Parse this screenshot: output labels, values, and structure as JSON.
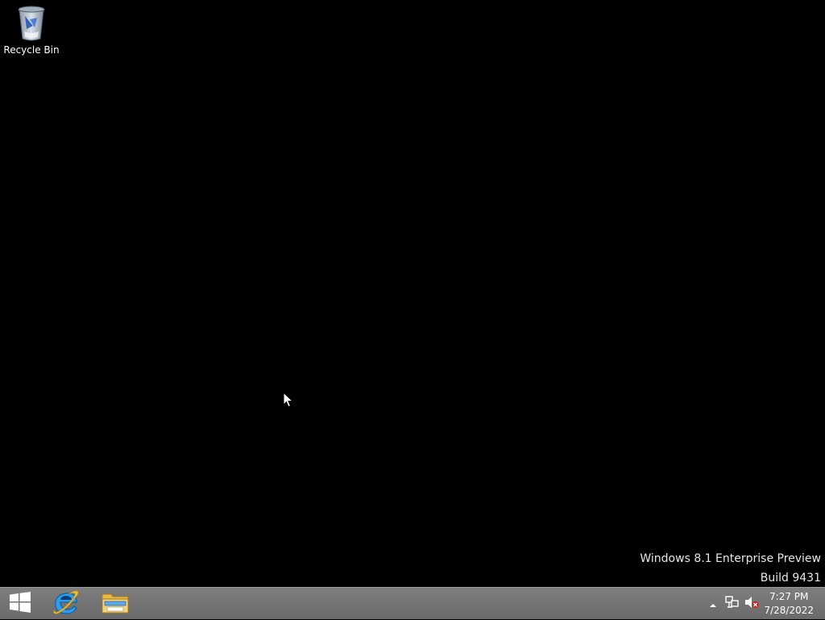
{
  "desktop": {
    "icons": [
      {
        "label": "Recycle Bin",
        "icon": "recycle-bin-icon"
      }
    ],
    "watermark": {
      "line1": "Windows 8.1 Enterprise Preview",
      "line2": "Build 9431"
    }
  },
  "taskbar": {
    "pinned": [
      {
        "name": "start",
        "icon": "windows-logo-icon"
      },
      {
        "name": "internet-explorer",
        "icon": "internet-explorer-icon"
      },
      {
        "name": "file-explorer",
        "icon": "folder-icon"
      }
    ],
    "tray": {
      "icons": [
        "show-hidden-icons-chevron",
        "network-icon",
        "volume-muted-icon"
      ]
    },
    "clock": {
      "time": "7:27 PM",
      "date": "7/28/2022"
    }
  },
  "colors": {
    "desktop_background": "#000000",
    "taskbar": "#747474",
    "text": "#ffffff"
  }
}
